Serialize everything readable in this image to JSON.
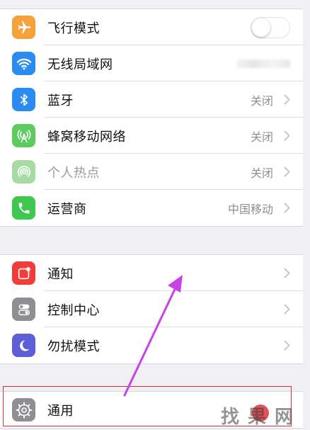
{
  "colors": {
    "airplane": "#f7a13a",
    "wifi": "#2a8cf3",
    "bluetooth": "#2a8cf3",
    "cellular": "#5ccc5e",
    "hotspot": "#a7dba4",
    "carrier": "#3ec84f",
    "notifications": "#f13c3a",
    "control_center": "#8e8e93",
    "dnd": "#5c5fd6",
    "general": "#8e8e93",
    "annotation_arrow": "#c644e6",
    "highlight_box": "#d7323c"
  },
  "group1": [
    {
      "id": "airplane",
      "icon": "airplane-icon",
      "label": "飞行模式",
      "control": "toggle",
      "toggle_on": false
    },
    {
      "id": "wifi",
      "icon": "wifi-icon",
      "label": "无线局域网",
      "value": ""
    },
    {
      "id": "bluetooth",
      "icon": "bluetooth-icon",
      "label": "蓝牙",
      "value": "关闭"
    },
    {
      "id": "cellular",
      "icon": "cellular-icon",
      "label": "蜂窝移动网络",
      "value": "关闭"
    },
    {
      "id": "hotspot",
      "icon": "hotspot-icon",
      "label": "个人热点",
      "value": "关闭"
    },
    {
      "id": "carrier",
      "icon": "phone-icon",
      "label": "运营商",
      "value": "中国移动"
    }
  ],
  "group2": [
    {
      "id": "notifications",
      "icon": "notifications-icon",
      "label": "通知"
    },
    {
      "id": "control_center",
      "icon": "control-center-icon",
      "label": "控制中心"
    },
    {
      "id": "dnd",
      "icon": "moon-icon",
      "label": "勿扰模式"
    }
  ],
  "group3": [
    {
      "id": "general",
      "icon": "gear-icon",
      "label": "通用"
    }
  ],
  "watermark": "找果网"
}
